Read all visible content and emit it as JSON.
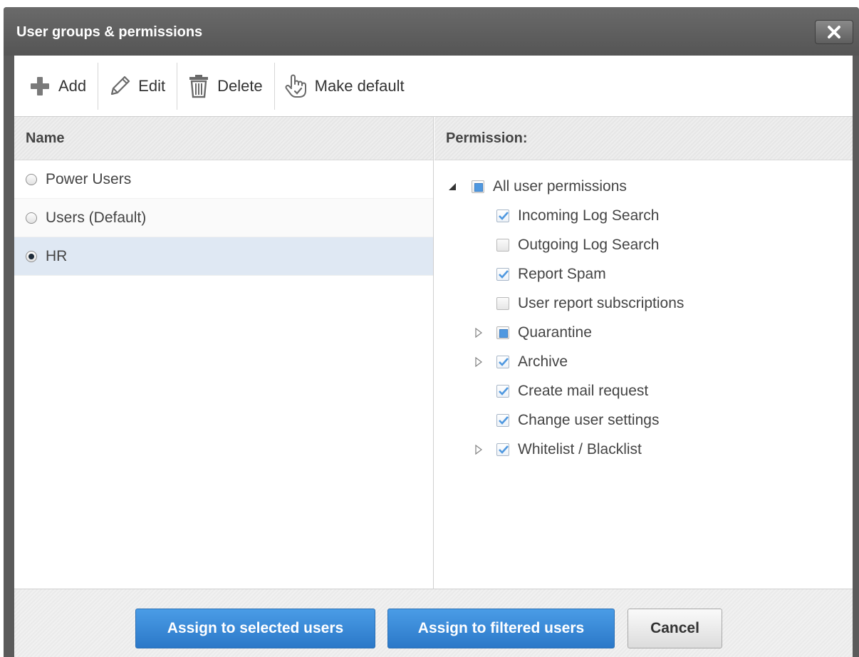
{
  "dialog": {
    "title": "User groups & permissions",
    "close_icon": "close-icon"
  },
  "toolbar": {
    "add_label": "Add",
    "edit_label": "Edit",
    "delete_label": "Delete",
    "make_default_label": "Make default"
  },
  "groups": {
    "header": "Name",
    "items": [
      {
        "label": "Power Users",
        "selected": false
      },
      {
        "label": "Users (Default)",
        "selected": false
      },
      {
        "label": "HR",
        "selected": true
      }
    ]
  },
  "permissions": {
    "header": "Permission:",
    "root": {
      "label": "All user permissions",
      "state": "partial",
      "expanded": true
    },
    "items": [
      {
        "label": "Incoming Log Search",
        "state": "checked",
        "expandable": false
      },
      {
        "label": "Outgoing Log Search",
        "state": "unchecked",
        "expandable": false
      },
      {
        "label": "Report Spam",
        "state": "checked",
        "expandable": false
      },
      {
        "label": "User report subscriptions",
        "state": "unchecked",
        "expandable": false
      },
      {
        "label": "Quarantine",
        "state": "partial",
        "expandable": true
      },
      {
        "label": "Archive",
        "state": "checked",
        "expandable": true
      },
      {
        "label": "Create mail request",
        "state": "checked",
        "expandable": false
      },
      {
        "label": "Change user settings",
        "state": "checked",
        "expandable": false
      },
      {
        "label": "Whitelist / Blacklist",
        "state": "checked",
        "expandable": true
      }
    ]
  },
  "footer": {
    "assign_selected_label": "Assign to selected users",
    "assign_filtered_label": "Assign to filtered users",
    "cancel_label": "Cancel"
  },
  "colors": {
    "titlebar": "#5b5b5b",
    "primary_button": "#3a8ad8",
    "selected_row": "#dfe8f3",
    "checkmark": "#4f98e0"
  }
}
